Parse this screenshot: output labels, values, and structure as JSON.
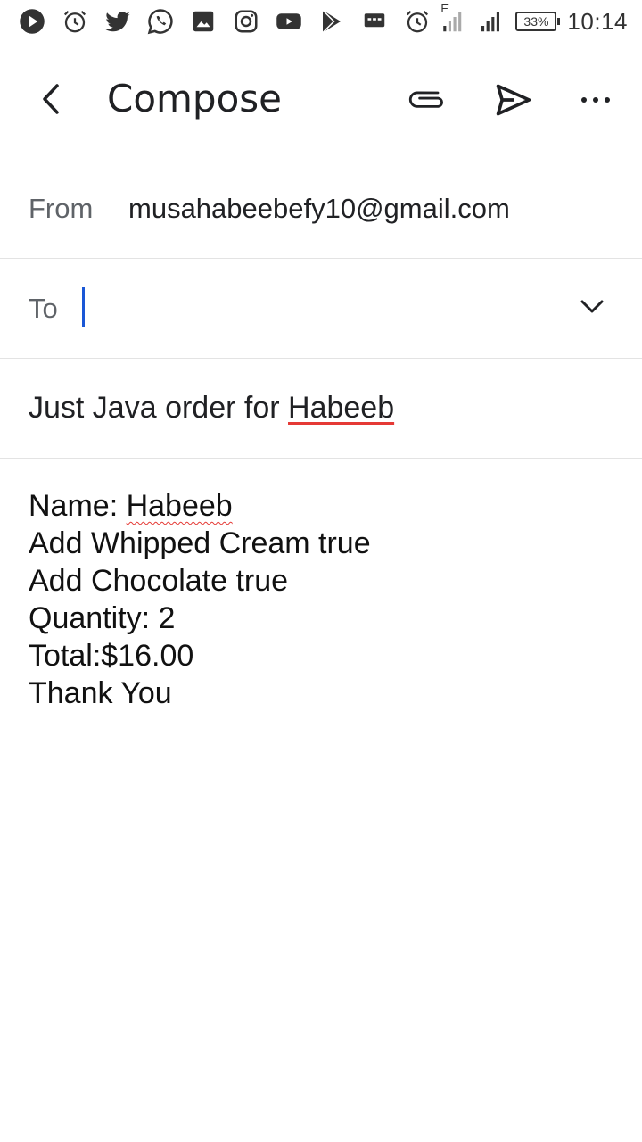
{
  "status_bar": {
    "icons": [
      "play-icon",
      "alarm-icon",
      "twitter-icon",
      "whatsapp-icon",
      "gallery-icon",
      "instagram-icon",
      "youtube-icon",
      "play-store-icon",
      "message-icon",
      "alarm-icon"
    ],
    "network_label": "E",
    "battery": "33%",
    "time": "10:14"
  },
  "app_bar": {
    "title": "Compose"
  },
  "from": {
    "label": "From",
    "value": "musahabeebefy10@gmail.com"
  },
  "to": {
    "label": "To",
    "value": "",
    "placeholder": ""
  },
  "subject": {
    "prefix": "Just Java order for ",
    "marked_word": "Habeeb"
  },
  "body": {
    "name_prefix": "Name: ",
    "name_value": "Habeeb",
    "lines": [
      "Add Whipped Cream true",
      "Add Chocolate true",
      "Quantity: 2",
      "Total:$16.00",
      "Thank You"
    ]
  },
  "colors": {
    "cursor": "#1a57d6",
    "spellcheck": "#e53935"
  }
}
